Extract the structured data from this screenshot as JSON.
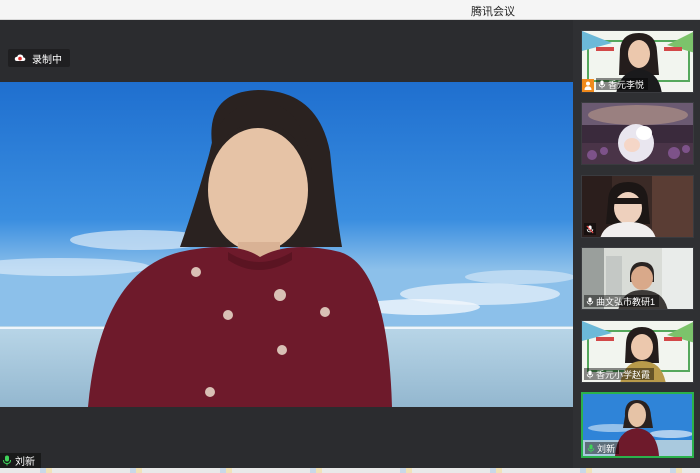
{
  "window": {
    "title": "腾讯会议"
  },
  "recording": {
    "label": "录制中"
  },
  "main_speaker": {
    "name": "刘新"
  },
  "participants": [
    {
      "name": "香元李悦",
      "role": "host"
    },
    {
      "name": ""
    },
    {
      "name": ""
    },
    {
      "name": "曲文弘市教研1"
    },
    {
      "name": "香元小学赵霞"
    },
    {
      "name": "刘新",
      "active": true
    }
  ],
  "colors": {
    "mic_on": "#3fd35a",
    "active_border": "#2bb24c",
    "host_badge": "#f08a1c"
  }
}
